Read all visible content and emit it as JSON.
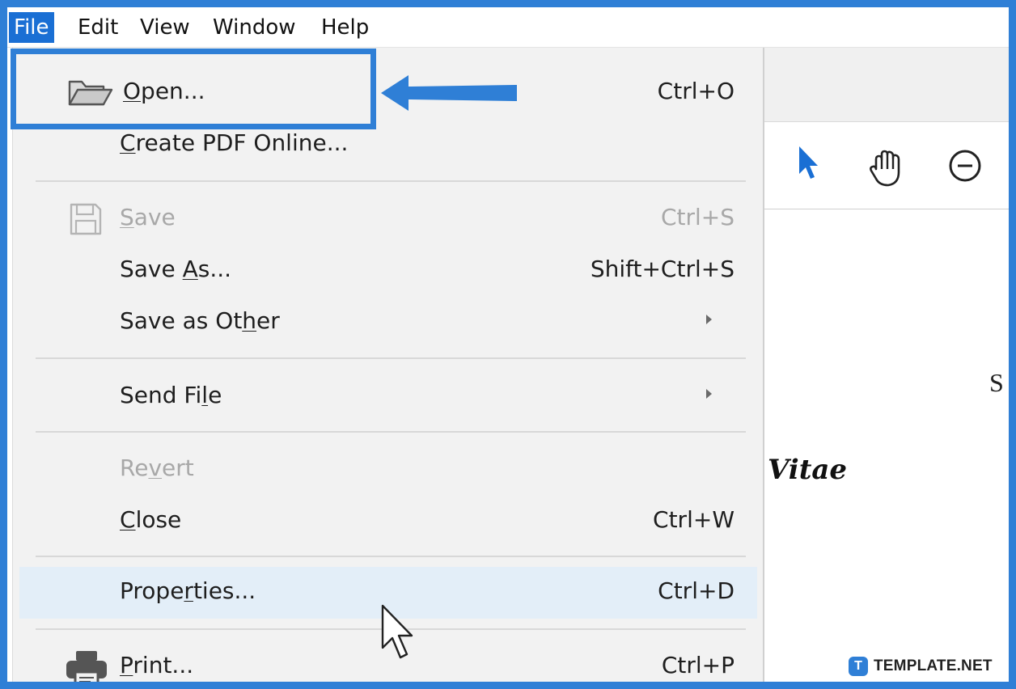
{
  "menubar": {
    "items": [
      "File",
      "Edit",
      "View",
      "Window",
      "Help"
    ]
  },
  "file_menu": {
    "items": [
      {
        "id": "open",
        "label": "Open...",
        "shortcut": "Ctrl+O",
        "icon": "folder-icon",
        "disabled": false
      },
      {
        "id": "create-pdf-online",
        "label": "Create PDF Online...",
        "shortcut": "",
        "disabled": false
      },
      {
        "id": "save",
        "label": "Save",
        "shortcut": "Ctrl+S",
        "icon": "save-icon",
        "disabled": true
      },
      {
        "id": "save-as",
        "label": "Save As...",
        "shortcut": "Shift+Ctrl+S",
        "disabled": false
      },
      {
        "id": "save-as-other",
        "label": "Save as Other",
        "submenu": true,
        "disabled": false
      },
      {
        "id": "send-file",
        "label": "Send File",
        "submenu": true,
        "disabled": false
      },
      {
        "id": "revert",
        "label": "Revert",
        "shortcut": "",
        "disabled": true
      },
      {
        "id": "close",
        "label": "Close",
        "shortcut": "Ctrl+W",
        "disabled": false
      },
      {
        "id": "properties",
        "label": "Properties...",
        "shortcut": "Ctrl+D",
        "hovered": true,
        "disabled": false
      },
      {
        "id": "print",
        "label": "Print...",
        "shortcut": "Ctrl+P",
        "icon": "printer-icon",
        "disabled": false
      }
    ]
  },
  "toolbar": {
    "icons": [
      "select-arrow-icon",
      "hand-tool-icon",
      "zoom-out-icon"
    ]
  },
  "document": {
    "partial_letter": "S",
    "title_fragment": "Vitae"
  },
  "watermark": {
    "logo_letter": "T",
    "text": "TEMPLATE.NET"
  },
  "colors": {
    "annotation": "#2f7fd6",
    "menu_bg": "#f2f2f2",
    "hover_bg": "#e3eef8",
    "active_menu": "#1a6fd4",
    "disabled_text": "#a8a8a8"
  }
}
